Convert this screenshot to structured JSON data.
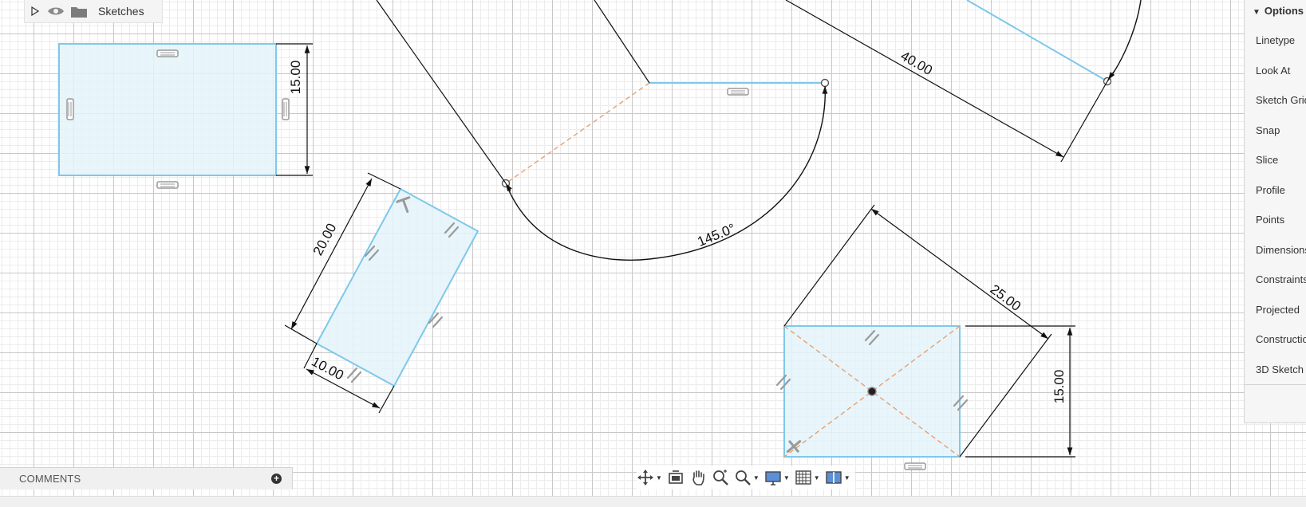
{
  "browser": {
    "label": "Sketches"
  },
  "options": {
    "header": "Options",
    "items": [
      "Linetype",
      "Look At",
      "Sketch Grid",
      "Snap",
      "Slice",
      "Profile",
      "Points",
      "Dimensions",
      "Constraints",
      "Projected",
      "Construction",
      "3D Sketch"
    ]
  },
  "comments": {
    "label": "COMMENTS",
    "add": "+"
  },
  "dimensions": {
    "rect_top_left_height": "15.00",
    "rotated_rect_length": "20.00",
    "rotated_rect_width": "10.00",
    "arc_angle": "145.0°",
    "line_length": "40.00",
    "diag_rect_size": "25.00",
    "diag_rect_height": "15.00"
  },
  "navbar": {
    "icons": [
      "orbit-icon",
      "look-at-icon",
      "pan-icon",
      "zoom-icon",
      "fit-icon",
      "display-settings-icon",
      "grid-settings-icon",
      "viewports-icon"
    ]
  },
  "colors": {
    "sketch_line": "#7ec8ea",
    "profile_fill": "#e4f3fa",
    "construction": "#e8a070",
    "dimension": "#111111",
    "constraint_glyph": "#9a9a9a"
  }
}
